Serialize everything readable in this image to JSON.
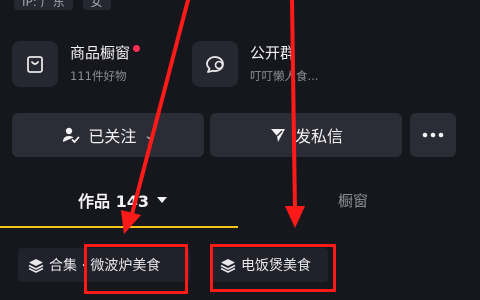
{
  "profile": {
    "ip_label": "IP: 广东",
    "gender": "女"
  },
  "shortcuts": [
    {
      "title": "商品橱窗",
      "subtitle": "111件好物",
      "has_badge": true,
      "icon": "shopping-bag-icon"
    },
    {
      "title": "公开群",
      "subtitle": "叮叮懒人食...",
      "has_badge": false,
      "icon": "chat-bubble-icon"
    }
  ],
  "actions": {
    "followed_label": "已关注",
    "message_label": "发私信",
    "more_icon": "more-dots-icon"
  },
  "tabs": [
    {
      "label": "作品 143",
      "active": true
    },
    {
      "label": "橱窗",
      "active": false
    }
  ],
  "collections": [
    {
      "label": "合集 · 微波炉美食"
    },
    {
      "label": "电饭煲美食"
    }
  ],
  "colors": {
    "background": "#16171c",
    "accent_underline": "#f5c518",
    "badge": "#ff2d55",
    "annotation_red": "#ff1a1a"
  }
}
